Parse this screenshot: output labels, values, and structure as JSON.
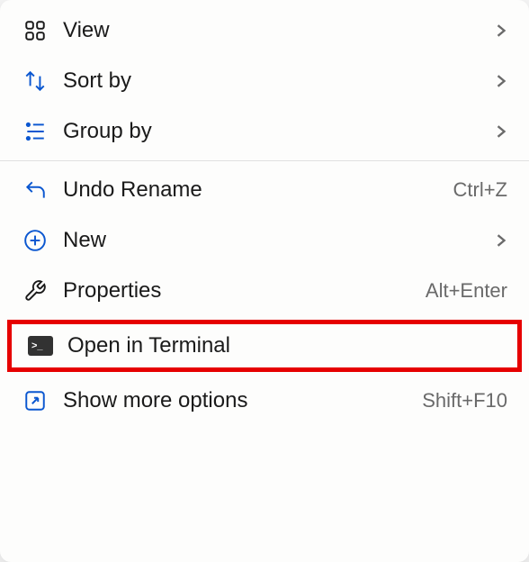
{
  "menu": {
    "items": [
      {
        "label": "View",
        "icon": "grid-icon",
        "hasSubmenu": true
      },
      {
        "label": "Sort by",
        "icon": "sort-icon",
        "hasSubmenu": true
      },
      {
        "label": "Group by",
        "icon": "group-icon",
        "hasSubmenu": true
      },
      {
        "label": "Undo Rename",
        "icon": "undo-icon",
        "shortcut": "Ctrl+Z"
      },
      {
        "label": "New",
        "icon": "plus-circle-icon",
        "hasSubmenu": true
      },
      {
        "label": "Properties",
        "icon": "wrench-icon",
        "shortcut": "Alt+Enter"
      },
      {
        "label": "Open in Terminal",
        "icon": "terminal-icon",
        "highlighted": true
      },
      {
        "label": "Show more options",
        "icon": "expand-icon",
        "shortcut": "Shift+F10"
      }
    ]
  }
}
